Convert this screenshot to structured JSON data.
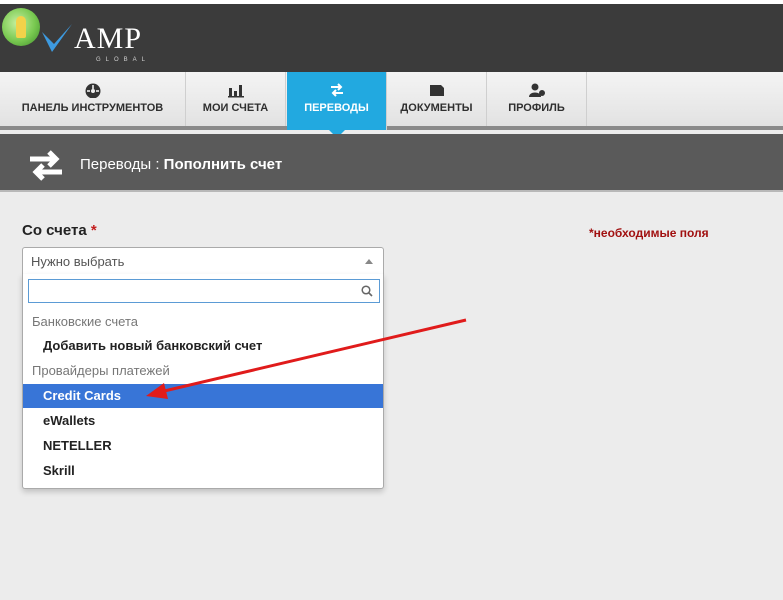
{
  "header": {
    "brand": "AMP",
    "brand_sub": "GLOBAL"
  },
  "nav": {
    "items": [
      {
        "label": "ПАНЕЛЬ ИНСТРУМЕНТОВ",
        "icon": "dashboard-icon"
      },
      {
        "label": "МОИ СЧЕТА",
        "icon": "bar-chart-icon"
      },
      {
        "label": "ПЕРЕВОДЫ",
        "icon": "transfer-icon",
        "active": true
      },
      {
        "label": "ДОКУМЕНТЫ",
        "icon": "folder-icon"
      },
      {
        "label": "ПРОФИЛЬ",
        "icon": "user-icon"
      }
    ]
  },
  "page_header": {
    "section": "Переводы :",
    "title": "Пополнить счет"
  },
  "form": {
    "from_account_label": "Со счета",
    "required_mark": "*",
    "required_note": "*необходимые поля",
    "select_placeholder": "Нужно выбрать",
    "search_value": "",
    "groups": [
      {
        "label": "Банковские счета",
        "options": [
          "Добавить новый банковский счет"
        ]
      },
      {
        "label": "Провайдеры платежей",
        "options": [
          "Credit Cards",
          "eWallets",
          "NETELLER",
          "Skrill"
        ]
      }
    ],
    "highlighted_option": "Credit Cards"
  },
  "colors": {
    "accent": "#22a9e0",
    "highlight": "#3875d7",
    "annotation_arrow": "#e01b1b",
    "required": "#a11010"
  }
}
